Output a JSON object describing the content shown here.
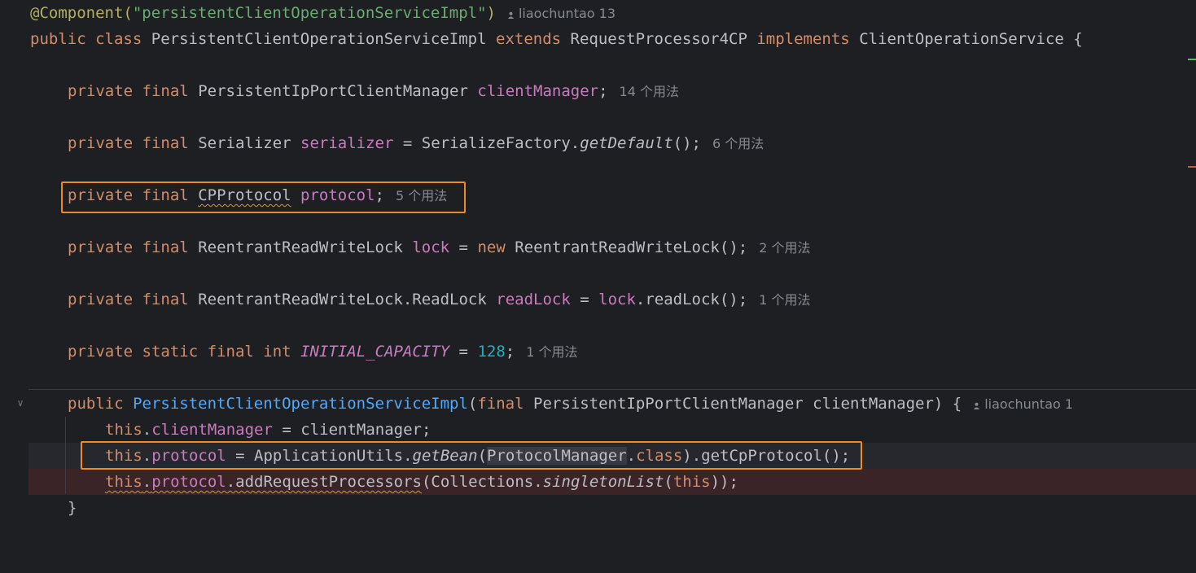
{
  "code": {
    "l1": {
      "annotation": "@Component(",
      "value": "\"persistentClientOperationServiceImpl\"",
      "close": ")",
      "author": "liaochuntao 13"
    },
    "l2": {
      "public": "public",
      "class": "class",
      "name": "PersistentClientOperationServiceImpl",
      "extends": "extends",
      "parent": "RequestProcessor4CP",
      "implements": "implements",
      "iface": "ClientOperationService",
      "brace": "{"
    },
    "l3": {
      "private": "private",
      "final": "final",
      "type": "PersistentIpPortClientManager",
      "field": "clientManager",
      "semi": ";",
      "usages": "14 个用法"
    },
    "l4": {
      "private": "private",
      "final": "final",
      "type": "Serializer",
      "field": "serializer",
      "eq": "=",
      "factory": "SerializeFactory.",
      "method": "getDefault",
      "rest": "();",
      "usages": "6 个用法"
    },
    "l5": {
      "private": "private",
      "final": "final",
      "type": "CPProtocol",
      "field": "protocol",
      "semi": ";",
      "usages": "5 个用法"
    },
    "l6": {
      "private": "private",
      "final": "final",
      "type": "ReentrantReadWriteLock",
      "field": "lock",
      "eq": "=",
      "new": "new",
      "ctor": "ReentrantReadWriteLock();",
      "usages": "2 个用法"
    },
    "l7": {
      "private": "private",
      "final": "final",
      "type": "ReentrantReadWriteLock.ReadLock",
      "field": "readLock",
      "eq": "=",
      "ref": "lock",
      "rest": ".readLock();",
      "usages": "1 个用法"
    },
    "l8": {
      "private": "private",
      "static": "static",
      "final": "final",
      "int": "int",
      "const": "INITIAL_CAPACITY",
      "eq": "=",
      "num": "128",
      "semi": ";",
      "usages": "1 个用法"
    },
    "l9": {
      "public": "public",
      "ctor": "PersistentClientOperationServiceImpl",
      "open": "(",
      "final": "final",
      "params": "PersistentIpPortClientManager clientManager) {",
      "author": "liaochuntao 1"
    },
    "l10": {
      "this": "this",
      "dot": ".",
      "field": "clientManager",
      "rest": " = clientManager;"
    },
    "l11": {
      "this": "this",
      "dot": ".",
      "field": "protocol",
      "mid": " = ApplicationUtils.",
      "method": "getBean",
      "open": "(",
      "cls": "ProtocolManager",
      "dot2": ".",
      "classkw": "class",
      "rest": ").getCpProtocol();"
    },
    "l12": {
      "this": "this",
      "dot": ".",
      "field": "protocol",
      "call": ".addRequestProcessors",
      "open": "(Collections.",
      "method": "singletonList",
      "open2": "(",
      "thiskw": "this",
      "rest": "));"
    },
    "l13": {
      "brace": "}"
    }
  },
  "colors": {
    "keyword": "#cf8e6d",
    "annotation": "#b3ae60",
    "string": "#6aab73",
    "field": "#c77dbb",
    "number": "#2aacb8",
    "function": "#56a8f5",
    "highlight_box": "#f08a24"
  },
  "icons": [
    "fold-chevron-icon",
    "lightbulb-icon",
    "user-icon"
  ]
}
